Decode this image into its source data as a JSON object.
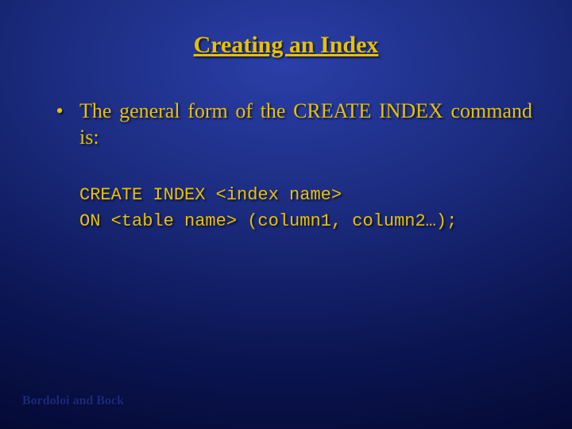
{
  "slide": {
    "title": "Creating an Index",
    "bullet": {
      "marker": "•",
      "text": "The general form of the CREATE INDEX command is:"
    },
    "code": {
      "line1": "CREATE INDEX <index name>",
      "line2": "ON <table name> (column1, column2…);"
    },
    "footer": "Bordoloi and Bock"
  }
}
